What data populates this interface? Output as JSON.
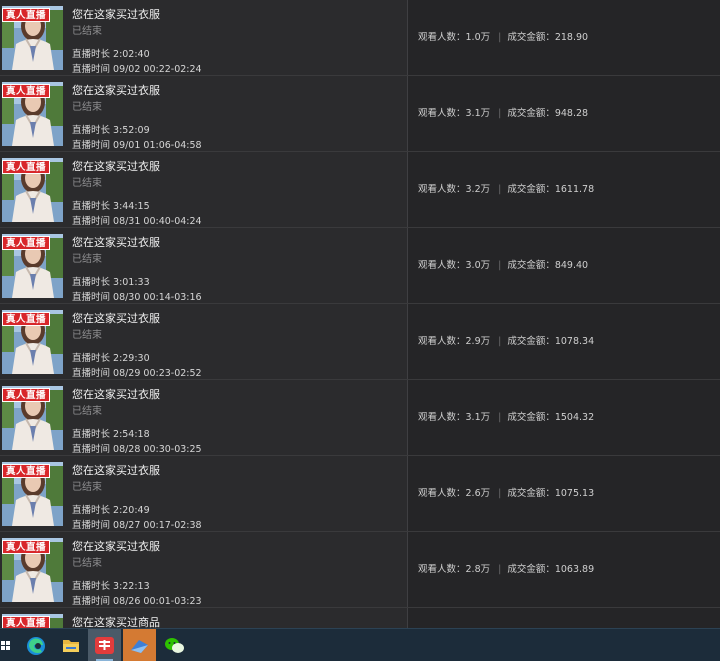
{
  "badge_label": "真人直播",
  "stat_labels": {
    "viewers": "观看人数：",
    "sales": "成交金额："
  },
  "sessions": [
    {
      "title": "您在这家买过衣服",
      "status": "已结束",
      "duration": "直播时长 2:02:40",
      "time": "直播时间 09/02 00:22-02:24",
      "viewers": "1.0万",
      "sales": "218.90"
    },
    {
      "title": "您在这家买过衣服",
      "status": "已结束",
      "duration": "直播时长 3:52:09",
      "time": "直播时间 09/01 01:06-04:58",
      "viewers": "3.1万",
      "sales": "948.28"
    },
    {
      "title": "您在这家买过衣服",
      "status": "已结束",
      "duration": "直播时长 3:44:15",
      "time": "直播时间 08/31 00:40-04:24",
      "viewers": "3.2万",
      "sales": "1611.78"
    },
    {
      "title": "您在这家买过衣服",
      "status": "已结束",
      "duration": "直播时长 3:01:33",
      "time": "直播时间 08/30 00:14-03:16",
      "viewers": "3.0万",
      "sales": "849.40"
    },
    {
      "title": "您在这家买过衣服",
      "status": "已结束",
      "duration": "直播时长 2:29:30",
      "time": "直播时间 08/29 00:23-02:52",
      "viewers": "2.9万",
      "sales": "1078.34"
    },
    {
      "title": "您在这家买过衣服",
      "status": "已结束",
      "duration": "直播时长 2:54:18",
      "time": "直播时间 08/28 00:30-03:25",
      "viewers": "3.1万",
      "sales": "1504.32"
    },
    {
      "title": "您在这家买过衣服",
      "status": "已结束",
      "duration": "直播时长 2:20:49",
      "time": "直播时间 08/27 00:17-02:38",
      "viewers": "2.6万",
      "sales": "1075.13"
    },
    {
      "title": "您在这家买过衣服",
      "status": "已结束",
      "duration": "直播时长 3:22:13",
      "time": "直播时间 08/26 00:01-03:23",
      "viewers": "2.8万",
      "sales": "1063.89"
    }
  ],
  "partial_session": {
    "title": "您在这家买过商品"
  },
  "taskbar": {
    "items": [
      {
        "name": "windows-start-icon"
      },
      {
        "name": "edge-browser-icon"
      },
      {
        "name": "file-explorer-icon"
      },
      {
        "name": "app-red-icon",
        "state": "active"
      },
      {
        "name": "app-blue-icon",
        "state": "active-orange"
      },
      {
        "name": "wechat-icon"
      }
    ]
  },
  "colors": {
    "badge": "#d8262a",
    "row_bg": "#2b2b2d",
    "stats_bg": "#252527",
    "taskbar_bg": "#1c2c3a"
  }
}
